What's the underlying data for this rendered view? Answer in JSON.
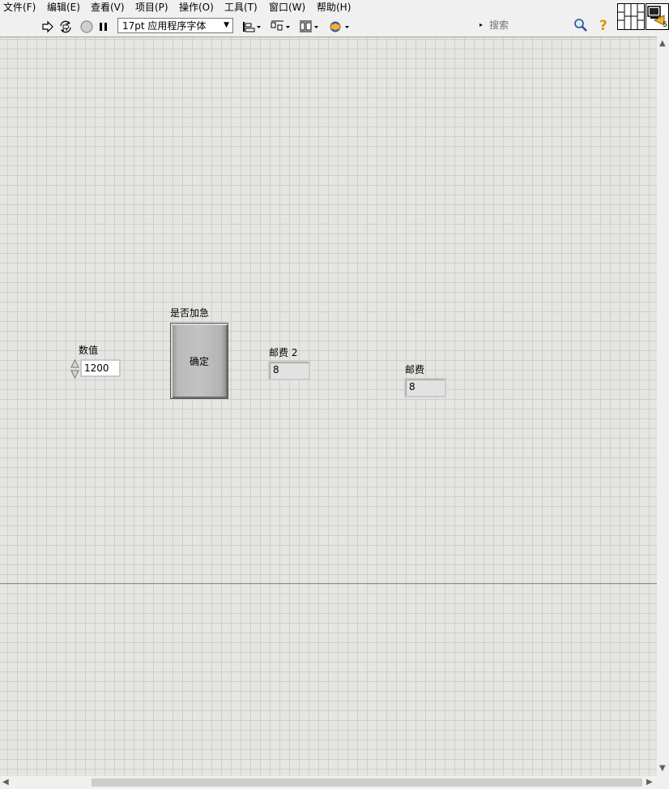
{
  "menu": {
    "items": [
      "文件(F)",
      "编辑(E)",
      "查看(V)",
      "项目(P)",
      "操作(O)",
      "工具(T)",
      "窗口(W)",
      "帮助(H)"
    ]
  },
  "toolbar": {
    "run_icon": "run-arrow-icon",
    "run_continuously_icon": "run-continuously-icon",
    "abort_icon": "abort-icon",
    "pause_icon": "pause-icon",
    "font_value": "17pt 应用程序字体",
    "align_icon": "align-objects-icon",
    "distribute_icon": "distribute-objects-icon",
    "resize_icon": "resize-objects-icon",
    "reorder_icon": "reorder-icon",
    "search_placeholder": "搜索",
    "search_icon": "magnifier-icon",
    "help_icon": "context-help-icon",
    "vi_icon_text": "5"
  },
  "panel": {
    "numeric_control": {
      "label": "数值",
      "value": "1200"
    },
    "boolean_button": {
      "label": "是否加急",
      "text": "确定"
    },
    "indicator_2": {
      "label": "邮费 2",
      "value": "8"
    },
    "indicator_1": {
      "label": "邮费",
      "value": "8"
    }
  },
  "colors": {
    "panel_bg": "#e5e5e2",
    "grid": "#cfcfca",
    "indicator_bg": "#e2e2e2",
    "button_face": "#c3c3c3"
  }
}
